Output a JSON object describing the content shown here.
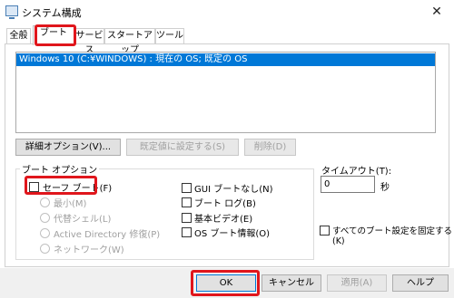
{
  "window": {
    "title": "システム構成",
    "close_glyph": "✕"
  },
  "tabs": [
    {
      "label": "全般"
    },
    {
      "label": "ブート"
    },
    {
      "label": "サービス"
    },
    {
      "label": "スタートアップ"
    },
    {
      "label": "ツール"
    }
  ],
  "os_list": {
    "rows": [
      "Windows 10 (C:¥WINDOWS) : 現在の OS; 既定の OS"
    ]
  },
  "boot_buttons": {
    "advanced": "詳細オプション(V)...",
    "set_default": "既定値に設定する(S)",
    "delete": "削除(D)"
  },
  "boot_options": {
    "group_label": "ブート オプション",
    "safe_boot": "セーフ ブート(F)",
    "minimal": "最小(M)",
    "alternate_shell": "代替シェル(L)",
    "active_directory": "Active Directory 修復(P)",
    "network": "ネットワーク(W)",
    "no_gui_boot": "GUI ブートなし(N)",
    "boot_log": "ブート ログ(B)",
    "base_video": "基本ビデオ(E)",
    "os_boot_info": "OS ブート情報(O)"
  },
  "timeout": {
    "label": "タイムアウト(T):",
    "value": "0",
    "unit": "秒"
  },
  "make_permanent": "すべてのブート設定を固定する(K)",
  "dialog_buttons": {
    "ok": "OK",
    "cancel": "キャンセル",
    "apply": "適用(A)",
    "help": "ヘルプ"
  },
  "colors": {
    "selection": "#0078d7",
    "highlight": "#e0161c"
  }
}
